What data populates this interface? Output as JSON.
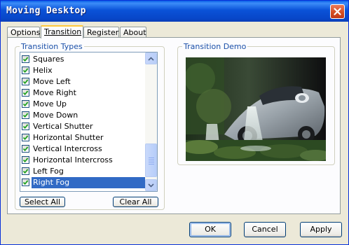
{
  "window": {
    "title": "Moving Desktop"
  },
  "tabs": [
    {
      "label": "Options",
      "active": false
    },
    {
      "label": "Transition",
      "active": true
    },
    {
      "label": "Register",
      "active": false
    },
    {
      "label": "About",
      "active": false
    }
  ],
  "transition_types": {
    "title": "Transition Types",
    "items": [
      {
        "label": "Squares",
        "checked": true
      },
      {
        "label": "Helix",
        "checked": true
      },
      {
        "label": "Move Left",
        "checked": true
      },
      {
        "label": "Move Right",
        "checked": true
      },
      {
        "label": "Move Up",
        "checked": true
      },
      {
        "label": "Move Down",
        "checked": true
      },
      {
        "label": "Vertical Shutter",
        "checked": true
      },
      {
        "label": "Horizontal Shutter",
        "checked": true
      },
      {
        "label": "Vertical Intercross",
        "checked": true
      },
      {
        "label": "Horizontal Intercross",
        "checked": true
      },
      {
        "label": "Left Fog",
        "checked": true
      },
      {
        "label": "Right Fog",
        "checked": true,
        "selected": true
      }
    ],
    "select_all": "Select All",
    "clear_all": "Clear All"
  },
  "demo": {
    "title": "Transition Demo"
  },
  "footer": {
    "ok": "OK",
    "cancel": "Cancel",
    "apply": "Apply"
  },
  "colors": {
    "title_bar": "#0a52d8",
    "selection": "#316ac5",
    "group_title": "#1a4fa8",
    "tab_highlight": "#ffc83c"
  }
}
